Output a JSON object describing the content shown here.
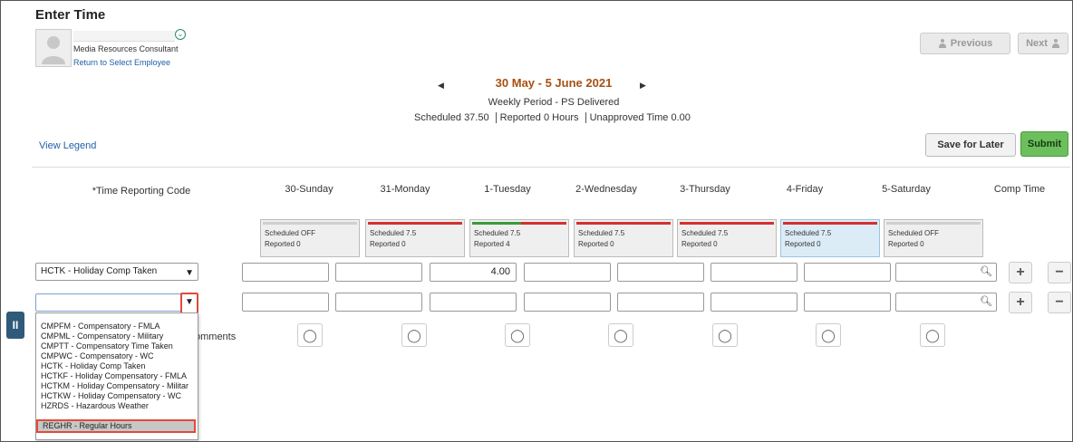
{
  "page": {
    "title": "Enter Time"
  },
  "employee": {
    "role": "Media Resources Consultant",
    "return_link": "Return to Select Employee"
  },
  "nav": {
    "previous_label": "Previous",
    "next_label": "Next"
  },
  "period": {
    "prev_arrow": "◀",
    "next_arrow": "▶",
    "title": "30 May - 5 June 2021",
    "subtitle": "Weekly Period - PS Delivered",
    "scheduled_label": "Scheduled",
    "scheduled_value": "37.50",
    "reported_label": "Reported",
    "reported_value": "0 Hours",
    "unapproved_label": "Unapproved Time",
    "unapproved_value": "0.00"
  },
  "actions": {
    "view_legend": "View Legend",
    "save_for_later": "Save for Later",
    "submit": "Submit"
  },
  "grid": {
    "trc_header": "*Time Reporting Code",
    "days": [
      {
        "label": "30-Sunday",
        "schedule": "Scheduled OFF",
        "reported": "Reported  0",
        "bar": "gray"
      },
      {
        "label": "31-Monday",
        "schedule": "Scheduled 7.5",
        "reported": "Reported  0",
        "bar": "red"
      },
      {
        "label": "1-Tuesday",
        "schedule": "Scheduled 7.5",
        "reported": "Reported  4",
        "bar": "split"
      },
      {
        "label": "2-Wednesday",
        "schedule": "Scheduled 7.5",
        "reported": "Reported  0",
        "bar": "red"
      },
      {
        "label": "3-Thursday",
        "schedule": "Scheduled 7.5",
        "reported": "Reported  0",
        "bar": "red"
      },
      {
        "label": "4-Friday",
        "schedule": "Scheduled 7.5",
        "reported": "Reported  0",
        "bar": "red"
      },
      {
        "label": "5-Saturday",
        "schedule": "Scheduled OFF",
        "reported": "Reported  0",
        "bar": "gray"
      }
    ],
    "comp_time_header": "Comp Time",
    "rows": [
      {
        "trc": "HCTK - Holiday Comp Taken",
        "hours": [
          "",
          "",
          "4.00",
          "",
          "",
          "",
          ""
        ]
      },
      {
        "trc": "",
        "hours": [
          "",
          "",
          "",
          "",
          "",
          "",
          ""
        ]
      }
    ],
    "comments_label": "omments"
  },
  "dropdown": {
    "options": [
      "CMPFM - Compensatory - FMLA",
      "CMPML - Compensatory - Military",
      "CMPTT - Compensatory Time Taken",
      "CMPWC - Compensatory - WC",
      "HCTK - Holiday Comp Taken",
      "HCTKF - Holiday Compensatory - FMLA",
      "HCTKM - Holiday Compensatory - Militar",
      "HCTKW - Holiday Compensatory - WC",
      "HZRDS - Hazardous Weather",
      "REGHR - Regular Hours"
    ],
    "highlighted": "REGHR - Regular Hours"
  },
  "colors": {
    "period_title": "#a85012",
    "link": "#2060a8",
    "submit_bg": "#6cbf5c",
    "alert_red": "#d43030",
    "ok_green": "#3a9a3a",
    "highlight_border": "#e24a3a"
  }
}
